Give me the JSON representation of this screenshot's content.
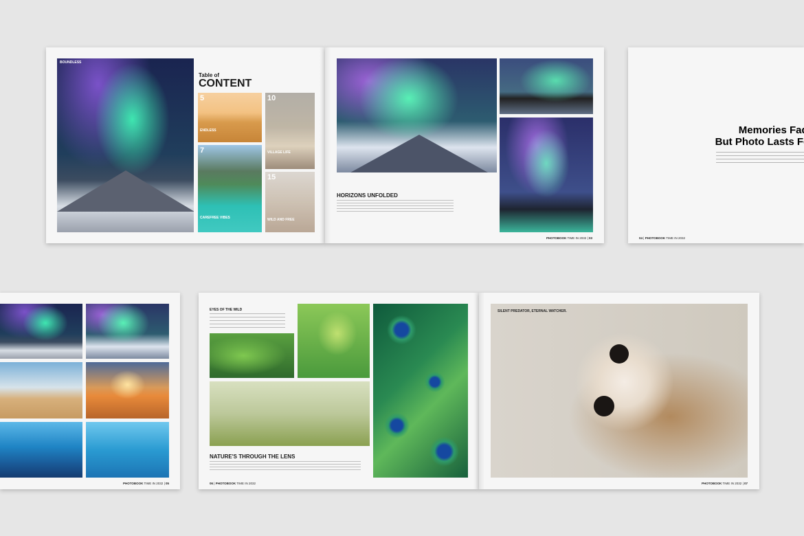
{
  "spread1": {
    "left": {
      "photo_title": "BOUNDLESS",
      "toc_label": "Table of",
      "toc_title": "CONTENT",
      "toc_items": [
        {
          "num": "5",
          "title": "ENDLESS"
        },
        {
          "num": "7",
          "title": "CAREFREE VIBES"
        },
        {
          "num": "10",
          "title": "VILLAGE LIFE"
        },
        {
          "num": "15",
          "title": "WILD AND FREE"
        }
      ]
    },
    "right": {
      "heading": "HORIZONS UNFOLDED",
      "footer_brand": "PHOTOBOOK",
      "footer_sub": "TIME IN 2032",
      "page_num": "03"
    }
  },
  "page04": {
    "heading_line1": "Memories Fade",
    "heading_line2": "But Photo Lasts For",
    "footer_num": "04",
    "footer_brand": "PHOTOBOOK",
    "footer_sub": "TIME IN 2032"
  },
  "page05": {
    "footer_brand": "PHOTOBOOK",
    "footer_sub": "TIME IN 2032",
    "page_num": "05"
  },
  "spread3": {
    "left": {
      "small_heading": "EYES OF THE WILD",
      "heading": "NATURE'S THROUGH THE LENS",
      "footer_num": "06",
      "footer_brand": "PHOTOBOOK",
      "footer_sub": "TIME IN 2032"
    },
    "right": {
      "caption": "SILENT PREDATOR, ETERNAL WATCHER.",
      "footer_brand": "PHOTOBOOK",
      "footer_sub": "TIME IN 2032",
      "page_num": "07"
    }
  }
}
